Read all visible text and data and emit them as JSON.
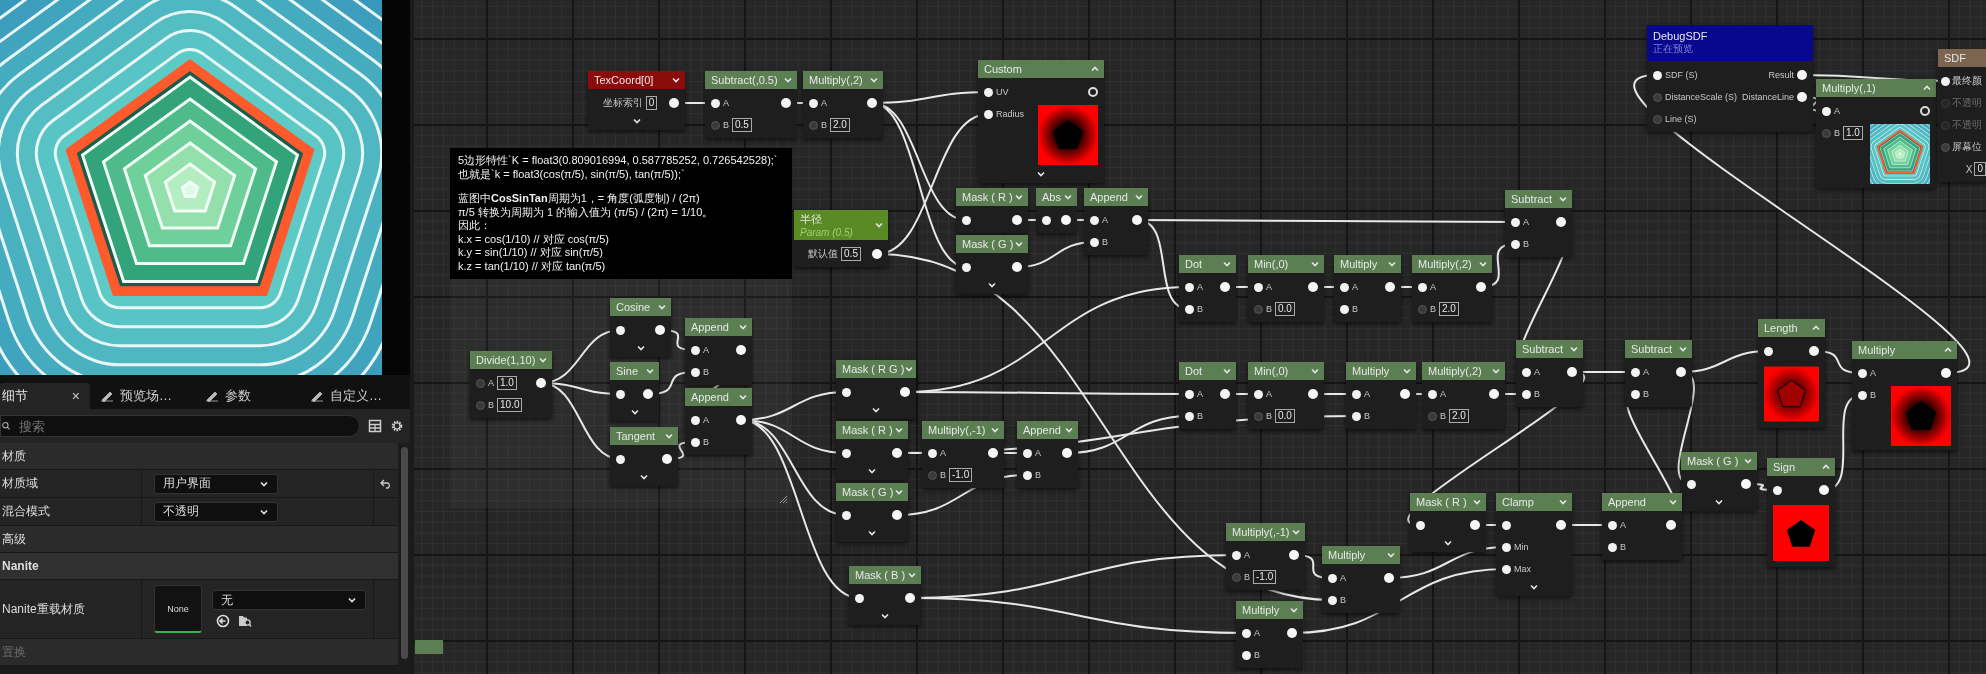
{
  "details": {
    "tabs": [
      {
        "label": "细节",
        "selected": true,
        "kind": "panel",
        "close": "×"
      },
      {
        "label": "预览场…",
        "selected": false,
        "kind": "tool"
      },
      {
        "label": "参数",
        "selected": false,
        "kind": "tool"
      },
      {
        "label": "自定义…",
        "selected": false,
        "kind": "tool"
      }
    ],
    "search": {
      "placeholder": "搜索"
    },
    "rows": [
      {
        "kind": "section",
        "label": "材质",
        "disabled": false
      },
      {
        "kind": "dropdown",
        "label": "材质域",
        "value": "用户界面",
        "resettable": true,
        "disabled": false
      },
      {
        "kind": "dropdown",
        "label": "混合模式",
        "value": "不透明",
        "resettable": false,
        "disabled": false
      },
      {
        "kind": "section",
        "label": "高级",
        "disabled": false
      },
      {
        "kind": "category",
        "label": "Nanite",
        "disabled": false
      },
      {
        "kind": "asset",
        "label": "Nanite重载材质",
        "thumbnail": "None",
        "value": "无",
        "disabled": false
      },
      {
        "kind": "section",
        "label": "置换",
        "disabled": true
      }
    ]
  },
  "comment": {
    "paragraphs": [
      [
        "5边形特性`K = float3(0.809016994, 0.587785252, 0.726542528);`",
        "也就是`k = float3(cos(π/5), sin(π/5), tan(π/5));`"
      ],
      [
        "蓝图中**CosSinTan**周期为1，= 角度(弧度制) / (2π)",
        "π/5 转换为周期为 1 的输入值为 (π/5) / (2π) = 1/10。",
        "因此：",
        "k.x = cos(1/10) // 对应 cos(π/5)",
        "k.y = sin(1/10) // 对应 sin(π/5)",
        "k.z = tan(1/10) // 对应 tan(π/5)"
      ]
    ]
  },
  "nodes": [
    {
      "title": "TexCoord[0]",
      "kind": "texcoord",
      "inputs": [
        {
          "kind": "property",
          "label": "坐标索引",
          "value": "0"
        }
      ],
      "outputs": [
        {
          "connected": true
        }
      ],
      "expandable": true
    },
    {
      "title": "Subtract(,0.5)",
      "kind": "function",
      "inputs": [
        {
          "label": "A",
          "connected": true
        },
        {
          "label": "B",
          "value": "0.5",
          "connected": false
        }
      ],
      "outputs": [
        {
          "connected": true
        }
      ],
      "expandable": false
    },
    {
      "title": "Multiply(,2)",
      "kind": "function",
      "inputs": [
        {
          "label": "A",
          "connected": true
        },
        {
          "label": "B",
          "value": "2.0",
          "connected": false
        }
      ],
      "outputs": [
        {
          "connected": true
        }
      ],
      "expandable": false
    },
    {
      "title": "Custom",
      "kind": "function",
      "inputs": [
        {
          "label": "UV",
          "connected": true
        },
        {
          "label": "Radius",
          "connected": true
        }
      ],
      "outputs": [
        {
          "connected": false
        }
      ],
      "preview": {
        "kind": "solid"
      },
      "expandable": true
    },
    {
      "title": "半径",
      "subtitle": "Param (0.5)",
      "kind": "param",
      "inputs": [
        {
          "kind": "property",
          "label": "默认值",
          "value": "0.5"
        }
      ],
      "outputs": [
        {
          "connected": true
        }
      ],
      "expandable": false
    },
    {
      "title": "Mask ( R )",
      "kind": "function",
      "inputs": [
        {
          "connected": true
        }
      ],
      "outputs": [
        {
          "connected": true
        }
      ],
      "expandable": false
    },
    {
      "title": "Mask ( G )",
      "kind": "function",
      "inputs": [
        {
          "connected": true
        }
      ],
      "outputs": [
        {
          "connected": true
        }
      ],
      "expandable": true
    },
    {
      "title": "Abs",
      "kind": "function",
      "inputs": [
        {
          "connected": true
        }
      ],
      "outputs": [
        {
          "connected": true
        }
      ],
      "expandable": false
    },
    {
      "title": "Append",
      "kind": "function",
      "inputs": [
        {
          "label": "A",
          "connected": true
        },
        {
          "label": "B",
          "connected": true
        }
      ],
      "outputs": [
        {
          "connected": true
        }
      ],
      "expandable": false
    },
    {
      "title": "Subtract",
      "kind": "function",
      "inputs": [
        {
          "label": "A",
          "connected": true
        },
        {
          "label": "B",
          "connected": true
        }
      ],
      "outputs": [
        {
          "connected": true
        }
      ],
      "expandable": false
    },
    {
      "title": "Dot",
      "kind": "function",
      "inputs": [
        {
          "label": "A",
          "connected": true
        },
        {
          "label": "B",
          "connected": true
        }
      ],
      "outputs": [
        {
          "connected": true
        }
      ],
      "expandable": false
    },
    {
      "title": "Min(,0)",
      "kind": "function",
      "inputs": [
        {
          "label": "A",
          "connected": true
        },
        {
          "label": "B",
          "value": "0.0",
          "connected": false
        }
      ],
      "outputs": [
        {
          "connected": true
        }
      ],
      "expandable": false
    },
    {
      "title": "Multiply",
      "kind": "function",
      "inputs": [
        {
          "label": "A",
          "connected": true
        },
        {
          "label": "B",
          "connected": true
        }
      ],
      "outputs": [
        {
          "connected": true
        }
      ],
      "expandable": false
    },
    {
      "title": "Multiply(,2)",
      "kind": "function",
      "inputs": [
        {
          "label": "A",
          "connected": true
        },
        {
          "label": "B",
          "value": "2.0",
          "connected": false
        }
      ],
      "outputs": [
        {
          "connected": true
        }
      ],
      "expandable": false
    },
    {
      "title": "Dot",
      "kind": "function",
      "inputs": [
        {
          "label": "A",
          "connected": true
        },
        {
          "label": "B",
          "connected": true
        }
      ],
      "outputs": [
        {
          "connected": true
        }
      ],
      "expandable": false
    },
    {
      "title": "Min(,0)",
      "kind": "function",
      "inputs": [
        {
          "label": "A",
          "connected": true
        },
        {
          "label": "B",
          "value": "0.0",
          "connected": false
        }
      ],
      "outputs": [
        {
          "connected": true
        }
      ],
      "expandable": false
    },
    {
      "title": "Multiply",
      "kind": "function",
      "inputs": [
        {
          "label": "A",
          "connected": true
        },
        {
          "label": "B",
          "connected": true
        }
      ],
      "outputs": [
        {
          "connected": true
        }
      ],
      "expandable": false
    },
    {
      "title": "Multiply(,2)",
      "kind": "function",
      "inputs": [
        {
          "label": "A",
          "connected": true
        },
        {
          "label": "B",
          "value": "2.0",
          "connected": false
        }
      ],
      "outputs": [
        {
          "connected": true
        }
      ],
      "expandable": false
    },
    {
      "title": "Subtract",
      "kind": "function",
      "inputs": [
        {
          "label": "A",
          "connected": true
        },
        {
          "label": "B",
          "connected": true
        }
      ],
      "outputs": [
        {
          "connected": true
        }
      ],
      "expandable": false
    },
    {
      "title": "Subtract",
      "kind": "function",
      "inputs": [
        {
          "label": "A",
          "connected": true
        },
        {
          "label": "B",
          "connected": true
        }
      ],
      "outputs": [
        {
          "connected": true
        }
      ],
      "expandable": false
    },
    {
      "title": "Length",
      "kind": "function",
      "inputs": [
        {
          "connected": true
        }
      ],
      "outputs": [
        {
          "connected": true
        }
      ],
      "preview": {
        "kind": "outline"
      },
      "expandable": false
    },
    {
      "title": "Multiply",
      "kind": "function",
      "inputs": [
        {
          "label": "A",
          "connected": true
        },
        {
          "label": "B",
          "connected": true
        }
      ],
      "outputs": [
        {
          "connected": true
        }
      ],
      "preview": {
        "kind": "solid"
      },
      "expandable": false
    },
    {
      "title": "Divide(1,10)",
      "kind": "function",
      "inputs": [
        {
          "label": "A",
          "value": "1.0",
          "connected": false
        },
        {
          "label": "B",
          "value": "10.0",
          "connected": false
        }
      ],
      "outputs": [
        {
          "connected": true
        }
      ],
      "expandable": false
    },
    {
      "title": "Cosine",
      "kind": "function",
      "inputs": [
        {
          "connected": true
        }
      ],
      "outputs": [
        {
          "connected": true
        }
      ],
      "expandable": true
    },
    {
      "title": "Sine",
      "kind": "function",
      "inputs": [
        {
          "connected": true
        }
      ],
      "outputs": [
        {
          "connected": true
        }
      ],
      "expandable": true
    },
    {
      "title": "Tangent",
      "kind": "function",
      "inputs": [
        {
          "connected": true
        }
      ],
      "outputs": [
        {
          "connected": true
        }
      ],
      "expandable": true
    },
    {
      "title": "Append",
      "kind": "function",
      "inputs": [
        {
          "label": "A",
          "connected": true
        },
        {
          "label": "B",
          "connected": true
        }
      ],
      "outputs": [
        {
          "connected": true
        }
      ],
      "expandable": false
    },
    {
      "title": "Append",
      "kind": "function",
      "inputs": [
        {
          "label": "A",
          "connected": true
        },
        {
          "label": "B",
          "connected": true
        }
      ],
      "outputs": [
        {
          "connected": true
        }
      ],
      "expandable": false
    },
    {
      "title": "Mask ( R G )",
      "kind": "function",
      "inputs": [
        {
          "connected": true
        }
      ],
      "outputs": [
        {
          "connected": true
        }
      ],
      "expandable": true
    },
    {
      "title": "Mask ( R )",
      "kind": "function",
      "inputs": [
        {
          "connected": true
        }
      ],
      "outputs": [
        {
          "connected": true
        }
      ],
      "expandable": true
    },
    {
      "title": "Multiply(,-1)",
      "kind": "function",
      "inputs": [
        {
          "label": "A",
          "connected": true
        },
        {
          "label": "B",
          "value": "-1.0",
          "connected": false
        }
      ],
      "outputs": [
        {
          "connected": true
        }
      ],
      "expandable": false
    },
    {
      "title": "Append",
      "kind": "function",
      "inputs": [
        {
          "label": "A",
          "connected": true
        },
        {
          "label": "B",
          "connected": true
        }
      ],
      "outputs": [
        {
          "connected": true
        }
      ],
      "expandable": false
    },
    {
      "title": "Mask ( G )",
      "kind": "function",
      "inputs": [
        {
          "connected": true
        }
      ],
      "outputs": [
        {
          "connected": true
        }
      ],
      "expandable": true
    },
    {
      "title": "Mask ( B )",
      "kind": "function",
      "inputs": [
        {
          "connected": true
        }
      ],
      "outputs": [
        {
          "connected": true
        }
      ],
      "expandable": true
    },
    {
      "title": "Mask ( G )",
      "kind": "function",
      "inputs": [
        {
          "connected": true
        }
      ],
      "outputs": [
        {
          "connected": true
        }
      ],
      "expandable": true
    },
    {
      "title": "Sign",
      "kind": "function",
      "inputs": [
        {
          "connected": true
        }
      ],
      "outputs": [
        {
          "connected": true
        }
      ],
      "preview": {
        "kind": "sign"
      },
      "expandable": false
    },
    {
      "title": "Mask ( R )",
      "kind": "function",
      "inputs": [
        {
          "connected": true
        }
      ],
      "outputs": [
        {
          "connected": true
        }
      ],
      "expandable": true
    },
    {
      "title": "Clamp",
      "kind": "function",
      "inputs": [
        {
          "connected": true
        },
        {
          "label": "Min",
          "connected": true
        },
        {
          "label": "Max",
          "connected": true
        }
      ],
      "outputs": [
        {
          "connected": true
        }
      ],
      "expandable": true
    },
    {
      "title": "Append",
      "kind": "function",
      "inputs": [
        {
          "label": "A",
          "connected": true
        },
        {
          "label": "B",
          "connected": true
        }
      ],
      "outputs": [
        {
          "connected": true
        }
      ],
      "expandable": false
    },
    {
      "title": "Multiply(,-1)",
      "kind": "function",
      "inputs": [
        {
          "label": "A",
          "connected": true
        },
        {
          "label": "B",
          "value": "-1.0",
          "connected": false
        }
      ],
      "outputs": [
        {
          "connected": true
        }
      ],
      "expandable": false
    },
    {
      "title": "Multiply",
      "kind": "function",
      "inputs": [
        {
          "label": "A",
          "connected": true
        },
        {
          "label": "B",
          "connected": true
        }
      ],
      "outputs": [
        {
          "connected": true
        }
      ],
      "expandable": false
    },
    {
      "title": "Multiply",
      "kind": "function",
      "inputs": [
        {
          "label": "A",
          "connected": true
        },
        {
          "label": "B",
          "connected": true
        }
      ],
      "outputs": [
        {
          "connected": true
        }
      ],
      "expandable": false
    },
    {
      "title": "DebugSDF",
      "subtitle": "正在预览",
      "kind": "debug",
      "inputs": [
        {
          "label": "SDF (S)",
          "connected": true
        },
        {
          "label": "DistanceScale (S)",
          "connected": false
        },
        {
          "label": "Line (S)",
          "connected": false
        }
      ],
      "outputs": [
        {
          "label": "Result",
          "connected": true
        },
        {
          "label": "DistanceLine",
          "connected": true
        }
      ],
      "expandable": false
    },
    {
      "title": "Multiply(,1)",
      "kind": "function",
      "inputs": [
        {
          "label": "A",
          "connected": true
        },
        {
          "label": "B",
          "value": "1.0",
          "connected": false
        }
      ],
      "outputs": [
        {
          "connected": false
        }
      ],
      "preview": {
        "kind": "sdf"
      },
      "expandable": false
    },
    {
      "title": "SDF",
      "kind": "result",
      "inputs": [
        {
          "label": "最终颜",
          "connected": true,
          "disabled": false
        },
        {
          "label": "不透明",
          "connected": false,
          "disabled": true
        },
        {
          "label": "不透明",
          "connected": false,
          "disabled": true
        },
        {
          "label": "屏幕位",
          "connected": false,
          "disabled": false
        },
        {
          "kind": "property",
          "label": "X",
          "value": "0",
          "disabled": false
        }
      ],
      "expandable": false
    }
  ]
}
